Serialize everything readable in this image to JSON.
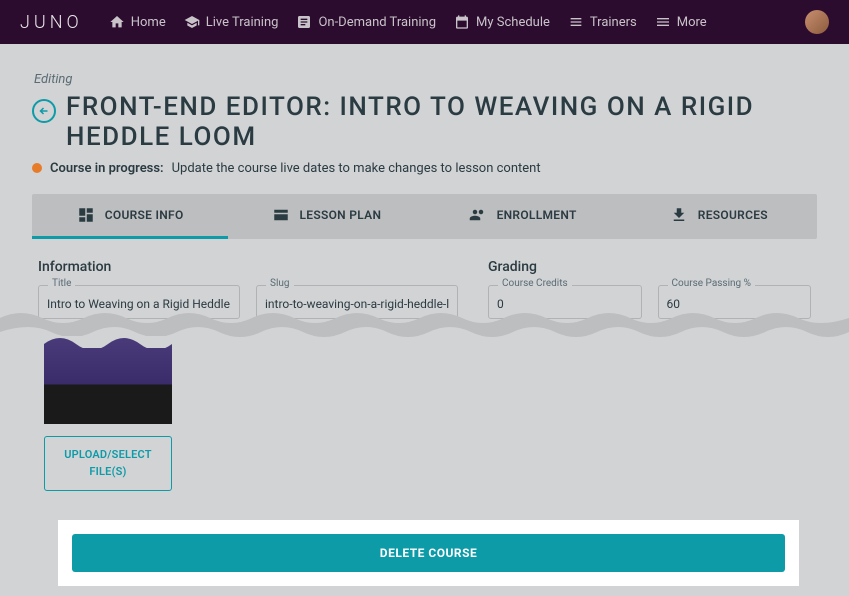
{
  "nav": {
    "logo": "JUNO",
    "items": [
      {
        "label": "Home"
      },
      {
        "label": "Live Training"
      },
      {
        "label": "On-Demand Training"
      },
      {
        "label": "My Schedule"
      },
      {
        "label": "Trainers"
      },
      {
        "label": "More"
      }
    ]
  },
  "page": {
    "editing_label": "Editing",
    "title": "FRONT-END EDITOR: INTRO TO WEAVING ON A RIGID HEDDLE LOOM",
    "status_label": "Course in progress:",
    "status_msg": "Update the course live dates to make changes to lesson content"
  },
  "tabs": [
    {
      "label": "COURSE INFO"
    },
    {
      "label": "LESSON PLAN"
    },
    {
      "label": "ENROLLMENT"
    },
    {
      "label": "RESOURCES"
    }
  ],
  "info": {
    "header": "Information",
    "title_label": "Title",
    "title_value": "Intro to Weaving on a Rigid Heddle Loom",
    "slug_label": "Slug",
    "slug_value": "intro-to-weaving-on-a-rigid-heddle-loom"
  },
  "grading": {
    "header": "Grading",
    "credits_label": "Course Credits",
    "credits_value": "0",
    "passing_label": "Course Passing %",
    "passing_value": "60"
  },
  "upload_label": "UPLOAD/SELECT FILE(S)",
  "delete_label": "DELETE COURSE"
}
